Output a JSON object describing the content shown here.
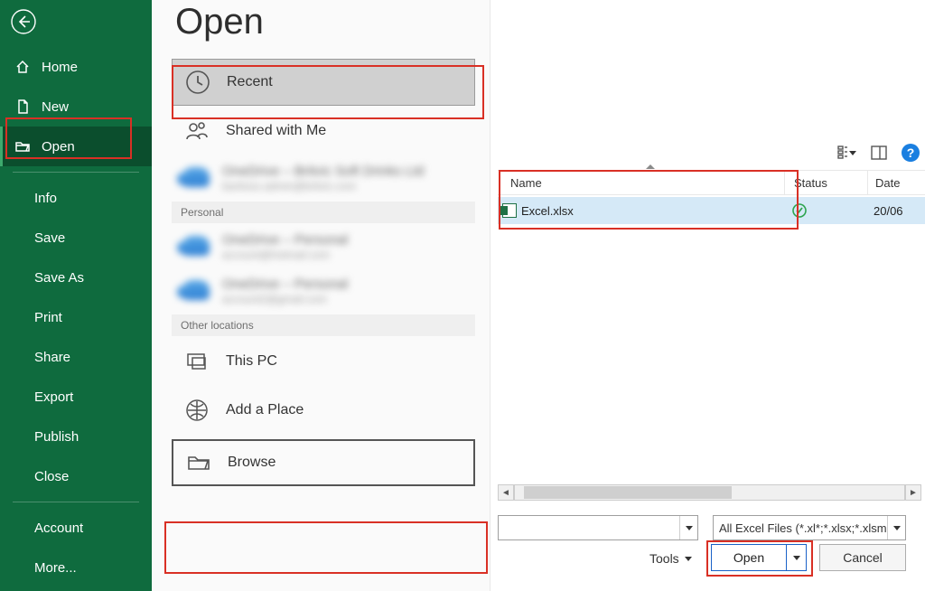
{
  "sidebar": {
    "items": [
      {
        "label": "Home"
      },
      {
        "label": "New"
      },
      {
        "label": "Open"
      },
      {
        "label": "Info"
      },
      {
        "label": "Save"
      },
      {
        "label": "Save As"
      },
      {
        "label": "Print"
      },
      {
        "label": "Share"
      },
      {
        "label": "Export"
      },
      {
        "label": "Publish"
      },
      {
        "label": "Close"
      },
      {
        "label": "Account"
      },
      {
        "label": "More..."
      }
    ]
  },
  "mid": {
    "title": "Open",
    "recent": "Recent",
    "shared": "Shared with Me",
    "personal_hdr": "Personal",
    "other_hdr": "Other locations",
    "thispc": "This PC",
    "addplace": "Add a Place",
    "browse": "Browse",
    "org": {
      "title": "OneDrive – Britvic Soft Drinks Ltd",
      "sub": "baritoso.admin@britvic.com"
    },
    "pers1": {
      "title": "OneDrive – Personal",
      "sub": "account@hotmail.com"
    },
    "pers2": {
      "title": "OneDrive – Personal",
      "sub": "account2@gmail.com"
    }
  },
  "dialog": {
    "cols": {
      "name": "Name",
      "status": "Status",
      "date": "Date"
    },
    "file": {
      "name": "Excel.xlsx",
      "date": "20/06"
    },
    "filter": "All Excel Files (*.xl*;*.xlsx;*.xlsm;*",
    "tools": "Tools",
    "open": "Open",
    "cancel": "Cancel",
    "help": "?"
  }
}
